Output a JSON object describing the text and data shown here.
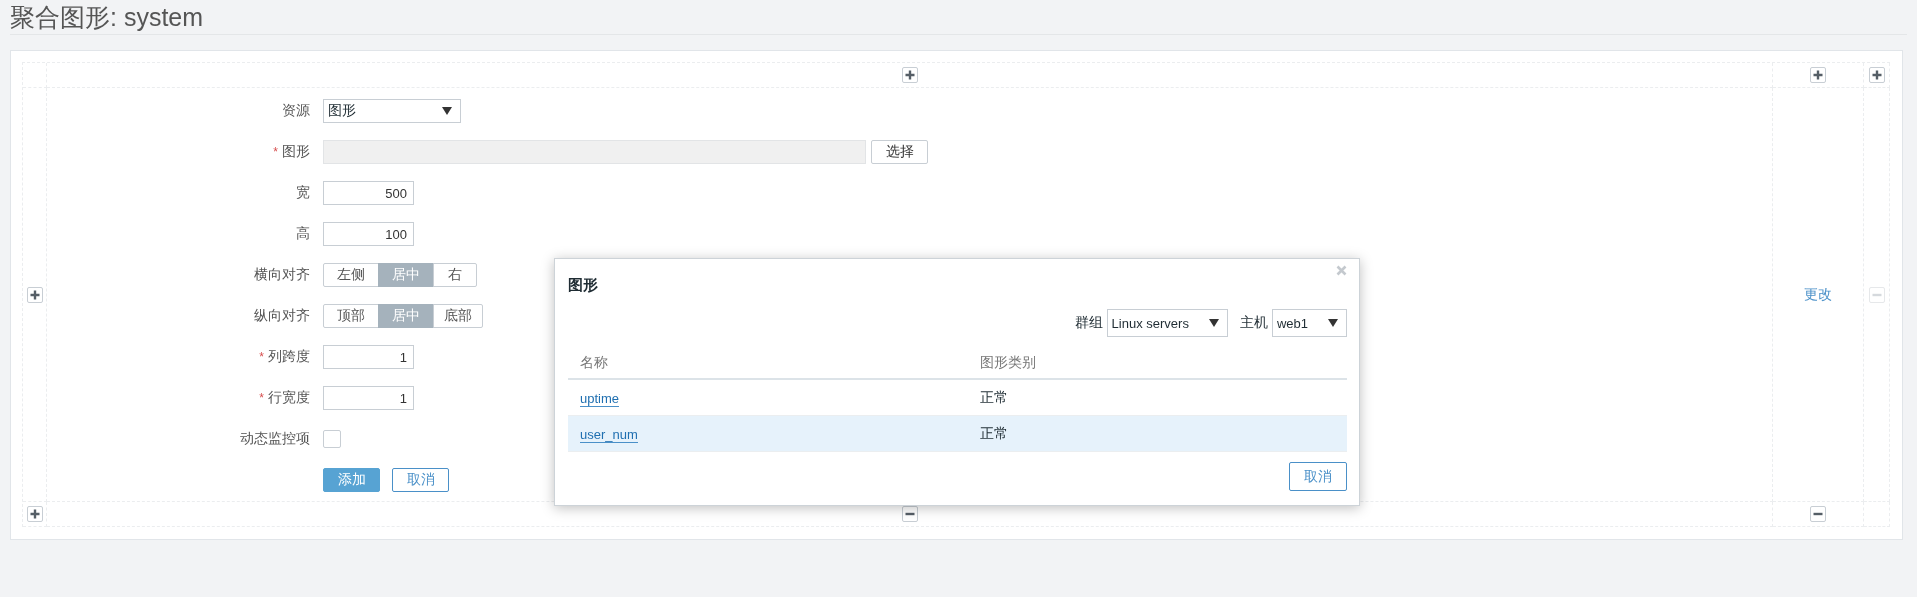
{
  "page_title": "聚合图形: system",
  "grid": {
    "top_buttons": [
      {
        "kind": "add",
        "disabled": false
      },
      {
        "kind": "add",
        "disabled": false
      },
      {
        "kind": "add",
        "disabled": false
      }
    ],
    "left_buttons": [
      {
        "kind": "add",
        "disabled": false
      },
      {
        "kind": "add",
        "disabled": false
      }
    ],
    "bottom_buttons": [
      {
        "kind": "remove",
        "disabled": false
      },
      {
        "kind": "remove",
        "disabled": false
      }
    ],
    "cell_link": "更改",
    "cell_button": {
      "kind": "remove",
      "disabled": true
    }
  },
  "form": {
    "fields": [
      {
        "kind": "select",
        "label": "资源",
        "value": "图形"
      },
      {
        "kind": "picker",
        "label": "图形",
        "required_mark": "*",
        "button": "选择"
      },
      {
        "kind": "number",
        "label": "宽",
        "value": "500"
      },
      {
        "kind": "number",
        "label": "高",
        "value": "100"
      },
      {
        "kind": "segmented",
        "label": "横向对齐",
        "options": [
          {
            "label": "左侧",
            "selected": false
          },
          {
            "label": "居中",
            "selected": true
          },
          {
            "label": "右",
            "selected": false
          }
        ]
      },
      {
        "kind": "segmented",
        "label": "纵向对齐",
        "options": [
          {
            "label": "顶部",
            "selected": false
          },
          {
            "label": "居中",
            "selected": true
          },
          {
            "label": "底部",
            "selected": false
          }
        ]
      },
      {
        "kind": "number",
        "label": "列跨度",
        "required_mark": "*",
        "value": "1"
      },
      {
        "kind": "number",
        "label": "行宽度",
        "required_mark": "*",
        "value": "1"
      },
      {
        "kind": "checkbox",
        "label": "动态监控项",
        "checked": false
      }
    ],
    "buttons": [
      {
        "label": "添加",
        "primary": true
      },
      {
        "label": "取消",
        "primary": false
      }
    ]
  },
  "dialog": {
    "title": "图形",
    "filters": [
      {
        "label": "群组",
        "value": "Linux servers"
      },
      {
        "label": "主机",
        "value": "web1"
      }
    ],
    "columns": [
      "名称",
      "图形类别"
    ],
    "rows": [
      {
        "name": "uptime",
        "type": "正常",
        "selected": false
      },
      {
        "name": "user_num",
        "type": "正常",
        "selected": true
      }
    ],
    "cancel": "取消"
  }
}
